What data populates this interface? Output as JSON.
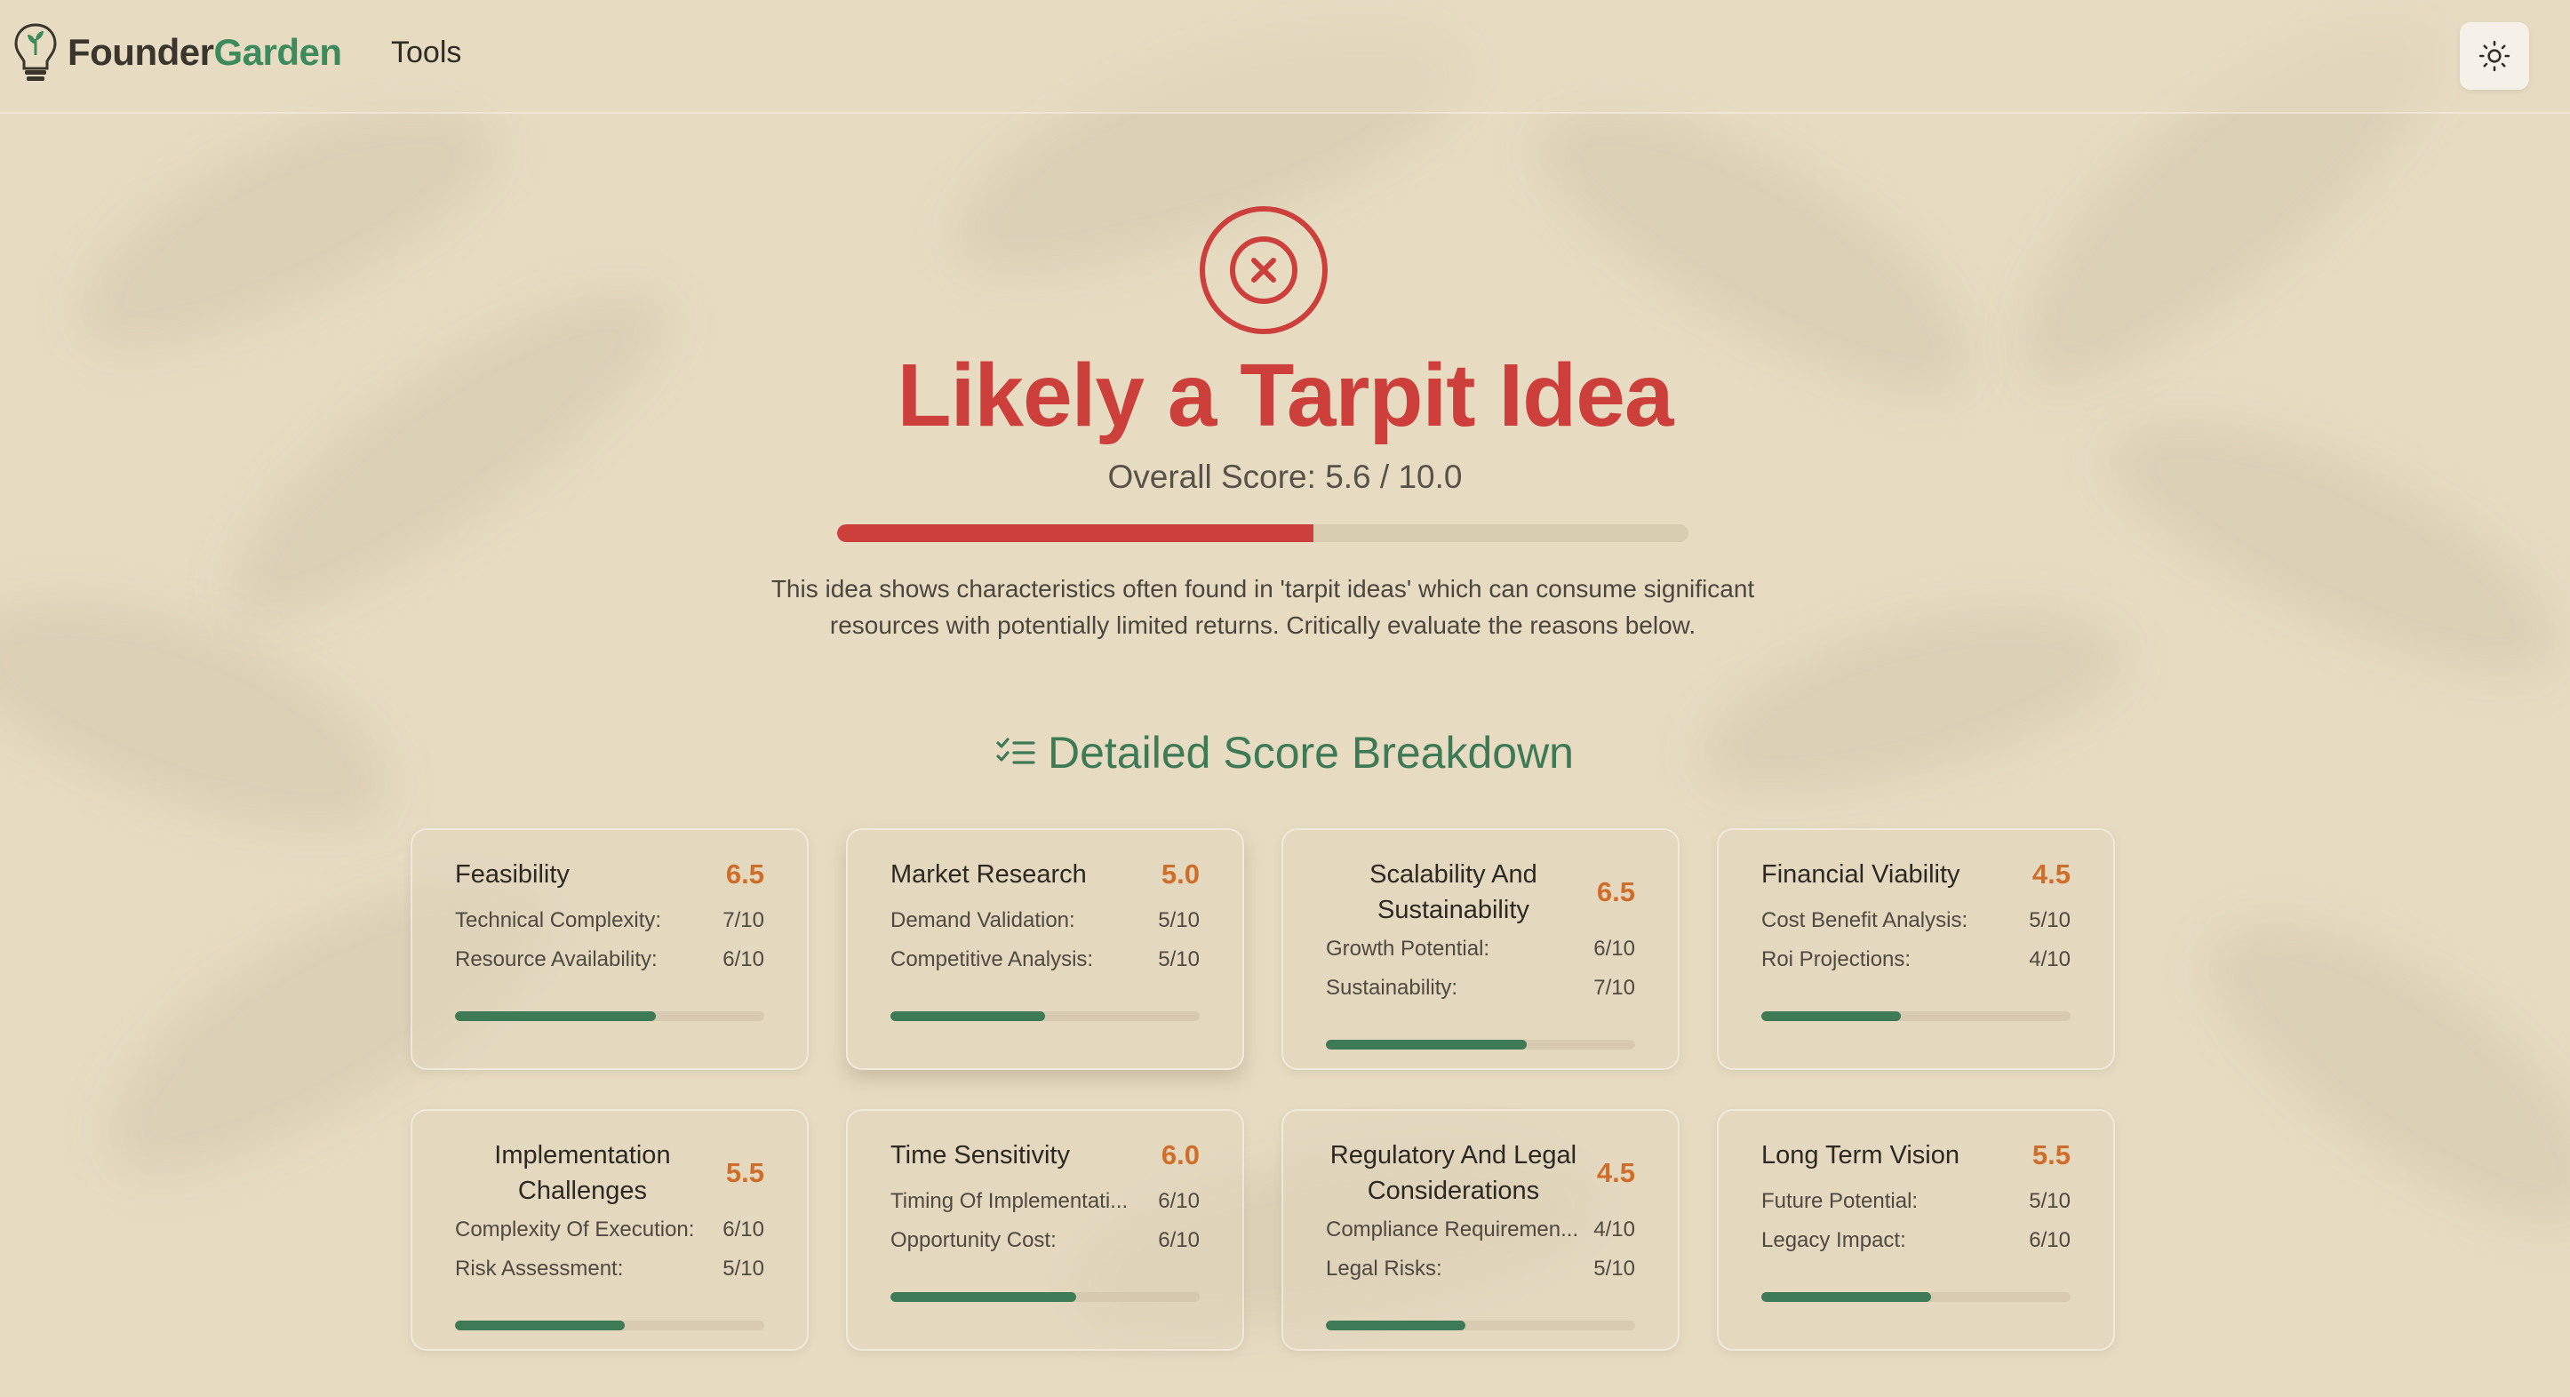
{
  "brand": {
    "name_part1": "Founder",
    "name_part2": "Garden"
  },
  "nav": {
    "tools": "Tools"
  },
  "result": {
    "verdict": "Likely a Tarpit Idea",
    "overall_score_text": "Overall Score: 5.6 / 10.0",
    "overall_score": 5.6,
    "overall_max": 10.0,
    "description": "This idea shows characteristics often found in 'tarpit ideas' which can consume significant resources with potentially limited returns. Critically evaluate the reasons below."
  },
  "breakdown": {
    "title": "Detailed Score Breakdown",
    "cards": [
      {
        "title": "Feasibility",
        "score": "6.5",
        "level": 0.65,
        "metrics": [
          {
            "label": "Technical Complexity:",
            "value": "7/10"
          },
          {
            "label": "Resource Availability:",
            "value": "6/10"
          }
        ]
      },
      {
        "title": "Market Research",
        "score": "5.0",
        "level": 0.5,
        "metrics": [
          {
            "label": "Demand Validation:",
            "value": "5/10"
          },
          {
            "label": "Competitive Analysis:",
            "value": "5/10"
          }
        ]
      },
      {
        "title": "Scalability And Sustainability",
        "score": "6.5",
        "level": 0.65,
        "metrics": [
          {
            "label": "Growth Potential:",
            "value": "6/10"
          },
          {
            "label": "Sustainability:",
            "value": "7/10"
          }
        ]
      },
      {
        "title": "Financial Viability",
        "score": "4.5",
        "level": 0.45,
        "metrics": [
          {
            "label": "Cost Benefit Analysis:",
            "value": "5/10"
          },
          {
            "label": "Roi Projections:",
            "value": "4/10"
          }
        ]
      },
      {
        "title": "Implementation Challenges",
        "score": "5.5",
        "level": 0.55,
        "metrics": [
          {
            "label": "Complexity Of Execution:",
            "value": "6/10"
          },
          {
            "label": "Risk Assessment:",
            "value": "5/10"
          }
        ]
      },
      {
        "title": "Time Sensitivity",
        "score": "6.0",
        "level": 0.6,
        "metrics": [
          {
            "label": "Timing Of Implementati...",
            "value": "6/10"
          },
          {
            "label": "Opportunity Cost:",
            "value": "6/10"
          }
        ]
      },
      {
        "title": "Regulatory And Legal Considerations",
        "score": "4.5",
        "level": 0.45,
        "metrics": [
          {
            "label": "Compliance Requiremen...",
            "value": "4/10"
          },
          {
            "label": "Legal Risks:",
            "value": "5/10"
          }
        ]
      },
      {
        "title": "Long Term Vision",
        "score": "5.5",
        "level": 0.55,
        "metrics": [
          {
            "label": "Future Potential:",
            "value": "5/10"
          },
          {
            "label": "Legacy Impact:",
            "value": "6/10"
          }
        ]
      }
    ]
  },
  "colors": {
    "danger": "#cc3f3a",
    "accent_green": "#3d7a55",
    "score_orange": "#cf6d2a",
    "background": "#e7dcc2"
  },
  "icons": {
    "logo": "lightbulb-sprout-icon",
    "theme": "sun-icon",
    "verdict": "x-circle-icon",
    "breakdown": "checklist-icon"
  }
}
